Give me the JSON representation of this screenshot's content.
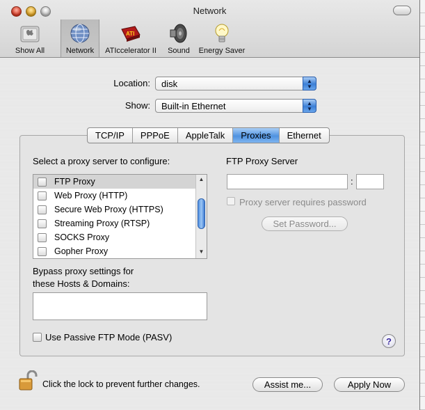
{
  "window": {
    "title": "Network"
  },
  "toolbar": {
    "items": [
      {
        "label": "Show All",
        "icon": "apple-icon"
      },
      {
        "label": "Network",
        "icon": "network-globe-icon"
      },
      {
        "label": "ATIccelerator II",
        "icon": "ati-icon"
      },
      {
        "label": "Sound",
        "icon": "speaker-icon"
      },
      {
        "label": "Energy Saver",
        "icon": "lightbulb-icon"
      }
    ],
    "selected": "Network"
  },
  "location": {
    "label": "Location:",
    "value": "disk"
  },
  "show": {
    "label": "Show:",
    "value": "Built-in Ethernet"
  },
  "tabs": [
    {
      "label": "TCP/IP",
      "active": false
    },
    {
      "label": "PPPoE",
      "active": false
    },
    {
      "label": "AppleTalk",
      "active": false
    },
    {
      "label": "Proxies",
      "active": true
    },
    {
      "label": "Ethernet",
      "active": false
    }
  ],
  "proxies": {
    "select_label": "Select a proxy server to configure:",
    "list": [
      {
        "label": "FTP Proxy",
        "checked": false
      },
      {
        "label": "Web Proxy (HTTP)",
        "checked": false
      },
      {
        "label": "Secure Web Proxy (HTTPS)",
        "checked": false
      },
      {
        "label": "Streaming Proxy (RTSP)",
        "checked": false
      },
      {
        "label": "SOCKS Proxy",
        "checked": false
      },
      {
        "label": "Gopher Proxy",
        "checked": false
      }
    ],
    "selected_index": 0,
    "server_heading": "FTP Proxy Server",
    "server_value": "",
    "port_separator": ":",
    "port_value": "",
    "requires_password_label": "Proxy server requires password",
    "set_password_label": "Set Password...",
    "bypass_label_line1": "Bypass proxy settings for",
    "bypass_label_line2": "these Hosts & Domains:",
    "bypass_value": "",
    "passive_label": "Use Passive FTP Mode (PASV)",
    "help_glyph": "?"
  },
  "footer": {
    "lock_text": "Click the lock to prevent further changes.",
    "assist_label": "Assist me...",
    "apply_label": "Apply Now"
  },
  "colors": {
    "accent": "#4f92e0",
    "lock": "#d89a3a"
  }
}
